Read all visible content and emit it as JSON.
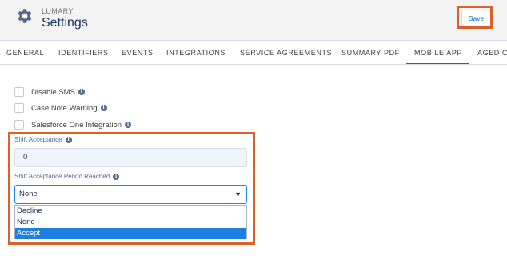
{
  "header": {
    "app_name": "LUMARY",
    "title": "Settings",
    "save_label": "Save"
  },
  "tabs": [
    {
      "label": "GENERAL"
    },
    {
      "label": "IDENTIFIERS"
    },
    {
      "label": "EVENTS"
    },
    {
      "label": "INTEGRATIONS"
    },
    {
      "label": "SERVICE AGREEMENTS"
    },
    {
      "label": "SUMMARY PDF"
    },
    {
      "label": "MOBILE APP",
      "active": true
    },
    {
      "label": "AGED C"
    }
  ],
  "checkboxes": [
    {
      "label": "Disable SMS",
      "checked": false
    },
    {
      "label": "Case Note Warning",
      "checked": false
    },
    {
      "label": "Salesforce One Integration",
      "checked": false
    }
  ],
  "shift_acceptance": {
    "label": "Shift Acceptance",
    "value": "0"
  },
  "shift_acceptance_period": {
    "label": "Shift Acceptance Period Reached",
    "selected": "None",
    "options": [
      "Decline",
      "None",
      "Accept"
    ],
    "highlighted_option": "Accept"
  },
  "colors": {
    "accent": "#0070d2",
    "highlight_border": "#d9622b",
    "option_highlight": "#1e7fe2"
  },
  "icons": {
    "app": "gear-icon",
    "info": "info-icon",
    "dropdown": "caret-down-icon"
  }
}
